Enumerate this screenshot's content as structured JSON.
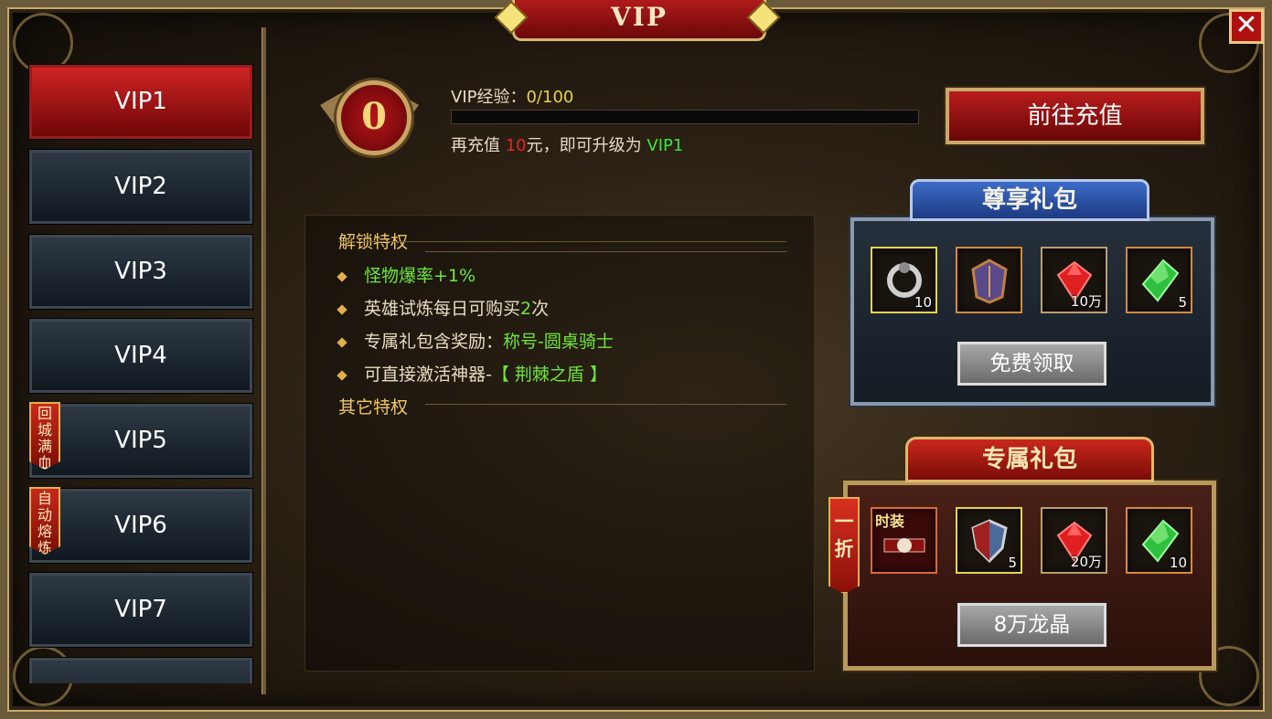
{
  "window": {
    "title": "VIP",
    "close_icon": "close-icon"
  },
  "sidebar": {
    "items": [
      {
        "label": "VIP1",
        "active": true
      },
      {
        "label": "VIP2"
      },
      {
        "label": "VIP3"
      },
      {
        "label": "VIP4"
      },
      {
        "label": "VIP5",
        "tag": "回城满血"
      },
      {
        "label": "VIP6",
        "tag": "自动熔炼"
      },
      {
        "label": "VIP7"
      }
    ]
  },
  "header": {
    "badge_level": "0",
    "exp_label": "VIP经验：",
    "exp_value": "0/100",
    "exp_progress": 0,
    "recharge_prefix": "再充值 ",
    "recharge_amount": "10",
    "recharge_mid": "元，即可升级为 ",
    "recharge_target": "VIP1",
    "go_recharge_label": "前往充值"
  },
  "privileges": {
    "unlock_title": "解锁特权",
    "items": [
      {
        "text": "怪物爆率+1%",
        "green": true
      },
      {
        "pre": "英雄试炼每日可购买",
        "hl": "2",
        "post": "次"
      },
      {
        "pre": "专属礼包含奖励：",
        "hl": "称号-圆桌骑士",
        "post": ""
      },
      {
        "pre": "可直接激活神器-",
        "hl": "【 荆棘之盾 】",
        "post": ""
      }
    ],
    "other_title": "其它特权"
  },
  "vip_pack": {
    "title": "尊享礼包",
    "items": [
      {
        "icon": "ring-icon",
        "qty": "10"
      },
      {
        "icon": "armor-icon",
        "qty": ""
      },
      {
        "icon": "ruby-icon",
        "qty": "10万"
      },
      {
        "icon": "emerald-icon",
        "qty": "5"
      }
    ],
    "button": "免费领取"
  },
  "exclusive_pack": {
    "title": "专属礼包",
    "discount": "一折",
    "items": [
      {
        "icon": "costume-icon",
        "label": "时装",
        "qty": ""
      },
      {
        "icon": "shield-icon",
        "qty": "5"
      },
      {
        "icon": "ruby-icon",
        "qty": "20万"
      },
      {
        "icon": "emerald-icon",
        "qty": "10"
      }
    ],
    "button": "8万龙晶"
  },
  "colors": {
    "accent_red": "#b01a1a",
    "gold": "#c9a96a",
    "exp_yellow": "#e8d24a",
    "green": "#3ee63a"
  }
}
